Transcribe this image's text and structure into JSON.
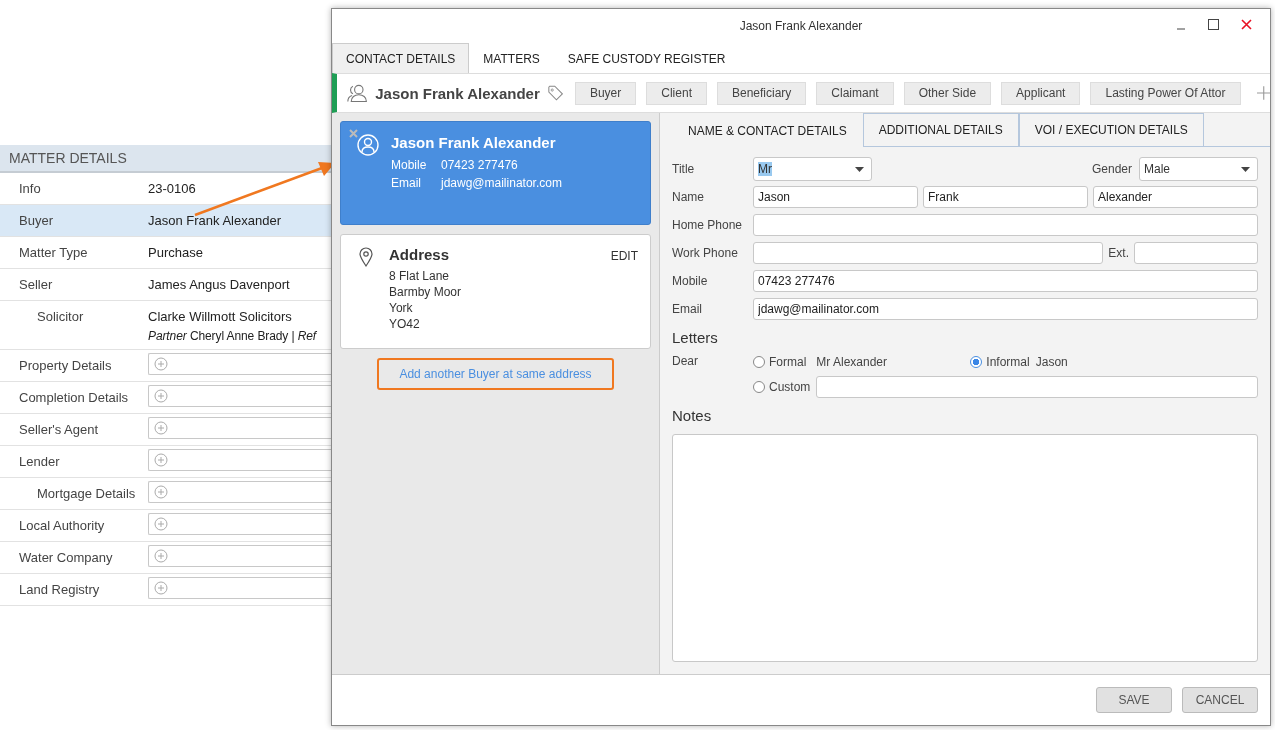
{
  "matter_details": {
    "title": "MATTER DETAILS",
    "rows": [
      {
        "label": "Info",
        "kind": "value",
        "value": "23-0106",
        "selected": false
      },
      {
        "label": "Buyer",
        "kind": "value",
        "value": "Jason Frank Alexander",
        "selected": true
      },
      {
        "label": "Matter Type",
        "kind": "value",
        "value": "Purchase",
        "selected": false
      },
      {
        "label": "Seller",
        "kind": "value",
        "value": "James Angus Davenport",
        "selected": false,
        "children": [
          {
            "label": "Solicitor",
            "kind": "value",
            "value": "Clarke Willmott Solicitors",
            "note": "*Partner* Cheryl Anne Brady | *Ref*",
            "selected": false
          }
        ]
      },
      {
        "label": "Property Details",
        "kind": "empty",
        "selected": false
      },
      {
        "label": "Completion Details",
        "kind": "empty",
        "selected": false
      },
      {
        "label": "Seller's Agent",
        "kind": "empty",
        "selected": false
      },
      {
        "label": "Lender",
        "kind": "empty",
        "selected": false,
        "children": [
          {
            "label": "Mortgage Details",
            "kind": "empty",
            "selected": false
          }
        ]
      },
      {
        "label": "Local Authority",
        "kind": "empty",
        "selected": false
      },
      {
        "label": "Water Company",
        "kind": "empty",
        "selected": false
      },
      {
        "label": "Land Registry",
        "kind": "empty",
        "selected": false
      }
    ]
  },
  "dialog": {
    "title": "Jason Frank Alexander",
    "tabs": [
      {
        "label": "CONTACT DETAILS",
        "selected": true
      },
      {
        "label": "MATTERS",
        "selected": false
      },
      {
        "label": "SAFE CUSTODY REGISTER",
        "selected": false
      }
    ],
    "contact": {
      "name": "Jason Frank Alexander",
      "tags": [
        "Buyer",
        "Client",
        "Beneficiary",
        "Claimant",
        "Other Side",
        "Applicant",
        "Lasting Power Of Attor"
      ]
    },
    "person_card": {
      "name": "Jason Frank Alexander",
      "selected": true,
      "lines": [
        {
          "label": "Mobile",
          "value": "07423 277476"
        },
        {
          "label": "Email",
          "value": "jdawg@mailinator.com"
        }
      ]
    },
    "address_card": {
      "title": "Address",
      "action": "EDIT",
      "lines": [
        "8 Flat Lane",
        "Barmby Moor",
        "York",
        "YO42"
      ]
    },
    "add_link": "Add another Buyer at same address",
    "form_tabs": [
      {
        "label": "NAME & CONTACT DETAILS",
        "selected": true
      },
      {
        "label": "ADDITIONAL DETAILS",
        "selected": false
      },
      {
        "label": "VOI / EXECUTION DETAILS",
        "selected": false
      }
    ],
    "form": {
      "title": {
        "label": "Title",
        "value": "Mr",
        "text_selected": true
      },
      "gender": {
        "label": "Gender",
        "value": "Male"
      },
      "name": {
        "label": "Name",
        "values": [
          "Jason",
          "Frank",
          "Alexander"
        ]
      },
      "home_phone": {
        "label": "Home Phone"
      },
      "work_phone": {
        "label": "Work Phone",
        "ext_label": "Ext."
      },
      "mobile": {
        "label": "Mobile",
        "value": "07423 277476"
      },
      "email": {
        "label": "Email",
        "value": "jdawg@mailinator.com"
      }
    },
    "letters": {
      "heading": "Letters",
      "label": "Dear",
      "options": [
        {
          "label": "Formal",
          "preview": "Mr Alexander",
          "selected": false
        },
        {
          "label": "Informal",
          "preview": "Jason",
          "selected": true
        },
        {
          "label": "Custom",
          "selected": false
        }
      ]
    },
    "notes": {
      "heading": "Notes"
    },
    "buttons": [
      "SAVE",
      "CANCEL"
    ]
  }
}
